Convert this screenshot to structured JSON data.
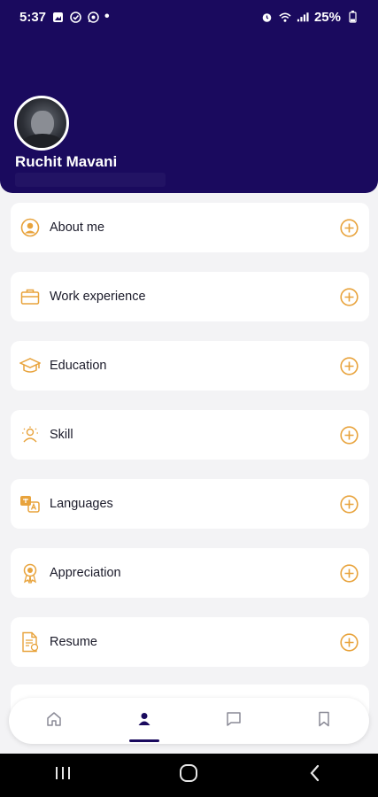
{
  "status_bar": {
    "time": "5:37",
    "battery": "25%",
    "left_icons": [
      "gallery-icon",
      "check-circle-icon",
      "whatsapp-icon"
    ],
    "right_icons": [
      "alarm-icon",
      "wifi-icon",
      "signal-icon",
      "battery-icon"
    ]
  },
  "profile": {
    "name": "Ruchit Mavani",
    "subtitle": ""
  },
  "sections": [
    {
      "label": "About me",
      "icon": "user-circle-icon"
    },
    {
      "label": "Work experience",
      "icon": "briefcase-icon"
    },
    {
      "label": "Education",
      "icon": "graduation-cap-icon"
    },
    {
      "label": "Skill",
      "icon": "skill-icon"
    },
    {
      "label": "Languages",
      "icon": "translate-icon"
    },
    {
      "label": "Appreciation",
      "icon": "award-icon"
    },
    {
      "label": "Resume",
      "icon": "document-icon"
    }
  ],
  "bottom_nav": {
    "items": [
      "home-icon",
      "profile-icon",
      "chat-icon",
      "bookmark-icon"
    ],
    "active": "profile-icon"
  },
  "colors": {
    "header": "#1a0a5e",
    "accent": "#e8a33c",
    "background": "#f3f3f5"
  }
}
